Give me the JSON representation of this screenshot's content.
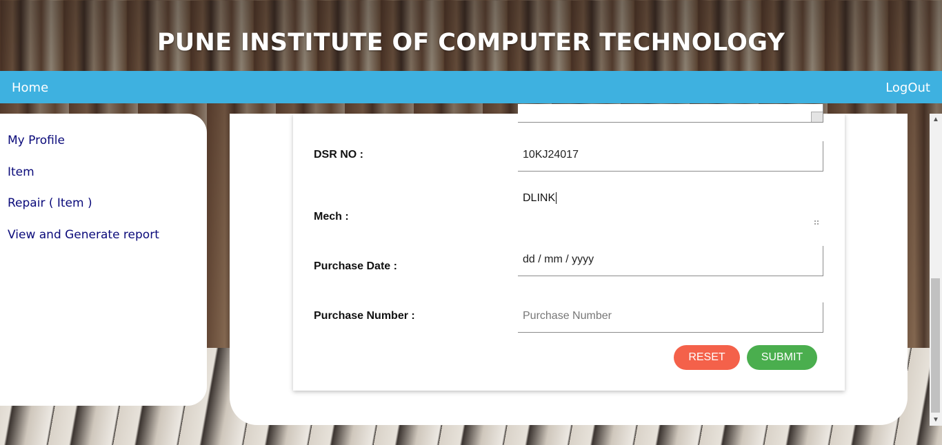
{
  "header": {
    "title": "PUNE INSTITUTE OF COMPUTER TECHNOLOGY"
  },
  "navbar": {
    "home_label": "Home",
    "logout_label": "LogOut"
  },
  "sidebar": {
    "items": [
      {
        "label": "My Profile"
      },
      {
        "label": "Item"
      },
      {
        "label": "Repair ( Item )"
      },
      {
        "label": "View and Generate report"
      }
    ]
  },
  "form": {
    "dsr_label": "DSR NO :",
    "dsr_value": "10KJ24017",
    "mech_label": "Mech :",
    "mech_value": "DLINK",
    "purchase_date_label": "Purchase Date :",
    "purchase_date_value": "dd / mm / yyyy",
    "purchase_number_label": "Purchase Number :",
    "purchase_number_placeholder": "Purchase Number",
    "reset_label": "RESET",
    "submit_label": "SUBMIT"
  },
  "scrollbar": {
    "up_icon": "▲",
    "down_icon": "▼"
  }
}
